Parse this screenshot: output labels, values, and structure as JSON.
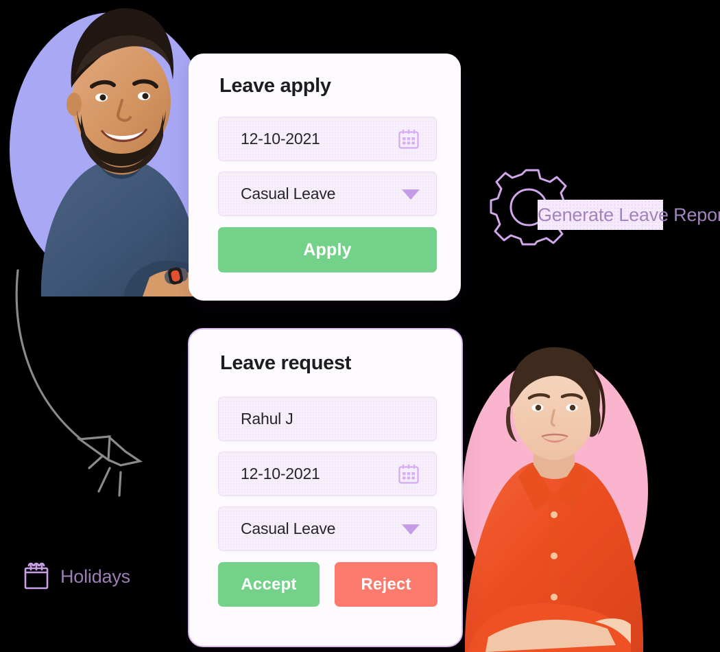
{
  "theme": {
    "background": "#000000",
    "card_background": "#fdfbfe",
    "card_border": "#ddb9f0",
    "field_background": "#f7f0fb",
    "field_border": "#ecd8f7",
    "accent_purple": "#c9a0e8",
    "label_purple": "#9d7fb5",
    "green": "#74d18a",
    "red": "#fb7a6c",
    "blob_purple": "#a8a8f5",
    "blob_pink": "#fbb4cd",
    "text_dark": "#1c1c22",
    "arrow_gray": "#8a8a8a"
  },
  "leave_apply": {
    "title": "Leave apply",
    "date_field": {
      "value": "12-10-2021",
      "icon": "calendar-icon"
    },
    "leave_type_field": {
      "value": "Casual Leave",
      "icon": "chevron-down-icon"
    },
    "apply_button": "Apply"
  },
  "leave_request": {
    "title": "Leave request",
    "name_field": {
      "value": "Rahul J"
    },
    "date_field": {
      "value": "12-10-2021",
      "icon": "calendar-icon"
    },
    "leave_type_field": {
      "value": "Casual Leave",
      "icon": "chevron-down-icon"
    },
    "accept_button": "Accept",
    "reject_button": "Reject"
  },
  "generate_report": {
    "label": "Generate Leave Report",
    "icon": "gear-icon"
  },
  "holidays": {
    "label": "Holidays",
    "icon": "calendar-icon"
  },
  "avatars": {
    "left": {
      "name": "employee-avatar-male",
      "blob_color": "#a8a8f5"
    },
    "right": {
      "name": "manager-avatar-female",
      "blob_color": "#fbb4cd"
    }
  },
  "decorations": {
    "arrow": "hand-drawn-curved-arrow"
  }
}
